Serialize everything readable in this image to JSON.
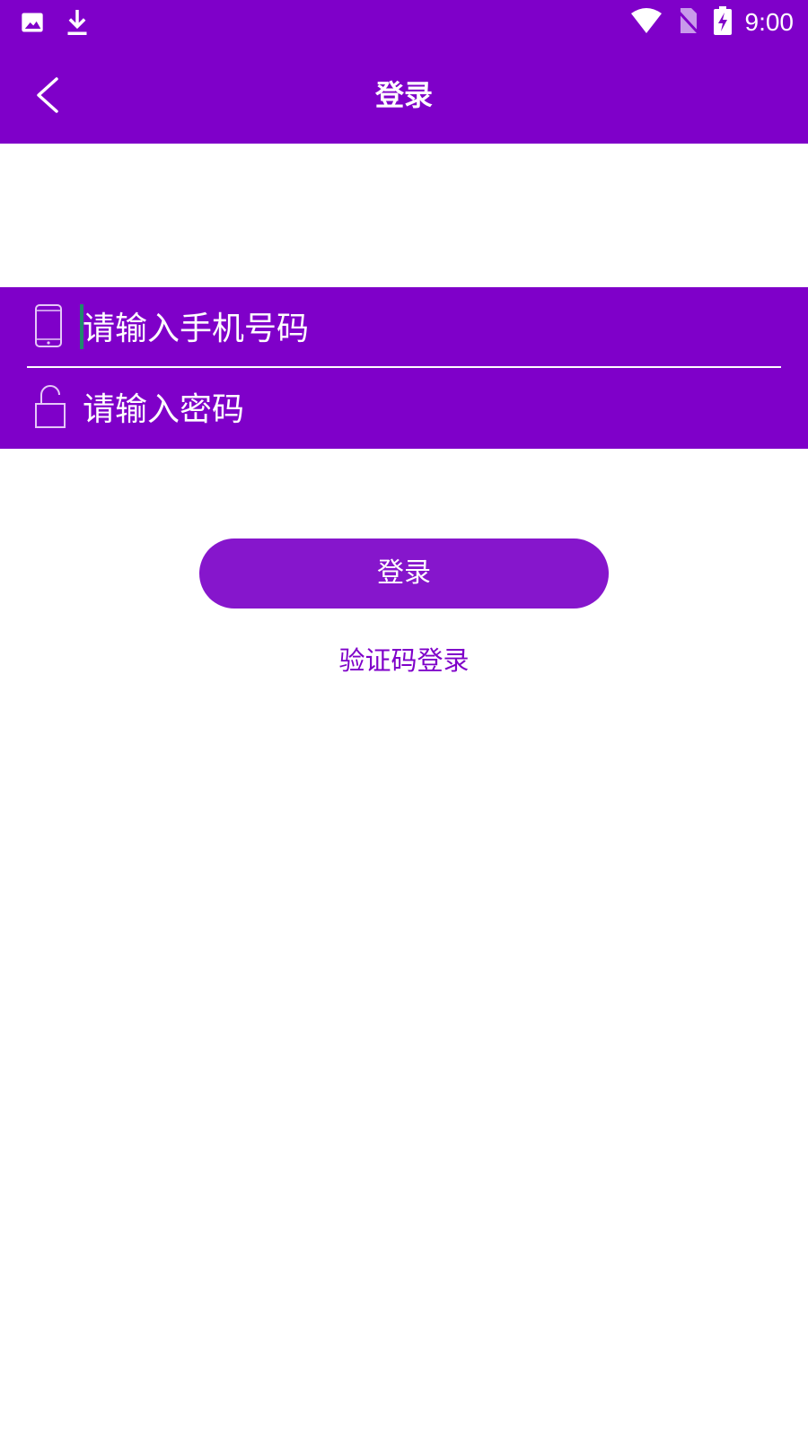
{
  "status_bar": {
    "time": "9:00",
    "icons": [
      "image-icon",
      "download-icon",
      "wifi-icon",
      "no-sim-icon",
      "battery-charging-icon"
    ]
  },
  "app_bar": {
    "title": "登录",
    "back_icon": "chevron-left-icon"
  },
  "form": {
    "phone": {
      "icon": "phone-icon",
      "placeholder": "请输入手机号码",
      "value": ""
    },
    "password": {
      "icon": "lock-open-icon",
      "placeholder": "请输入密码",
      "value": ""
    }
  },
  "actions": {
    "login_label": "登录",
    "sms_login_label": "验证码登录"
  },
  "colors": {
    "primary": "#7f00c9",
    "button": "#8616cc",
    "background": "#ffffff",
    "caret": "#1f8a6c"
  }
}
